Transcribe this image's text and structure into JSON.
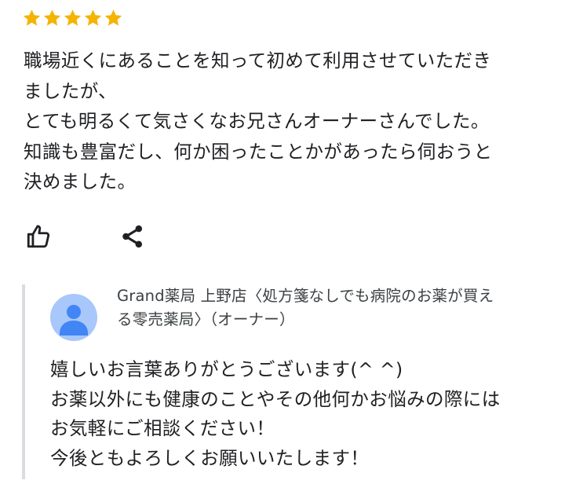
{
  "review": {
    "rating": 5,
    "star_color": "#f4b400",
    "lines": [
      "職場近くにあることを知って初めて利用させていただき",
      "ましたが、",
      "とても明るくて気さくなお兄さんオーナーさんでした。",
      "知識も豊富だし、何か困ったことかがあったら伺おうと",
      "決めました。"
    ]
  },
  "actions": {
    "like_icon": "thumb-up-outline",
    "share_icon": "share"
  },
  "owner_reply": {
    "avatar_color": "#4285f4",
    "name_lines": [
      "Grand薬局 上野店〈処方箋なしでも病院のお薬が買え",
      "る零売薬局〉（オーナー）"
    ],
    "lines": [
      "嬉しいお言葉ありがとうございます(^ ^)",
      "お薬以外にも健康のことやその他何かお悩みの際には",
      "お気軽にご相談ください！",
      "今後ともよろしくお願いいたします！"
    ]
  }
}
